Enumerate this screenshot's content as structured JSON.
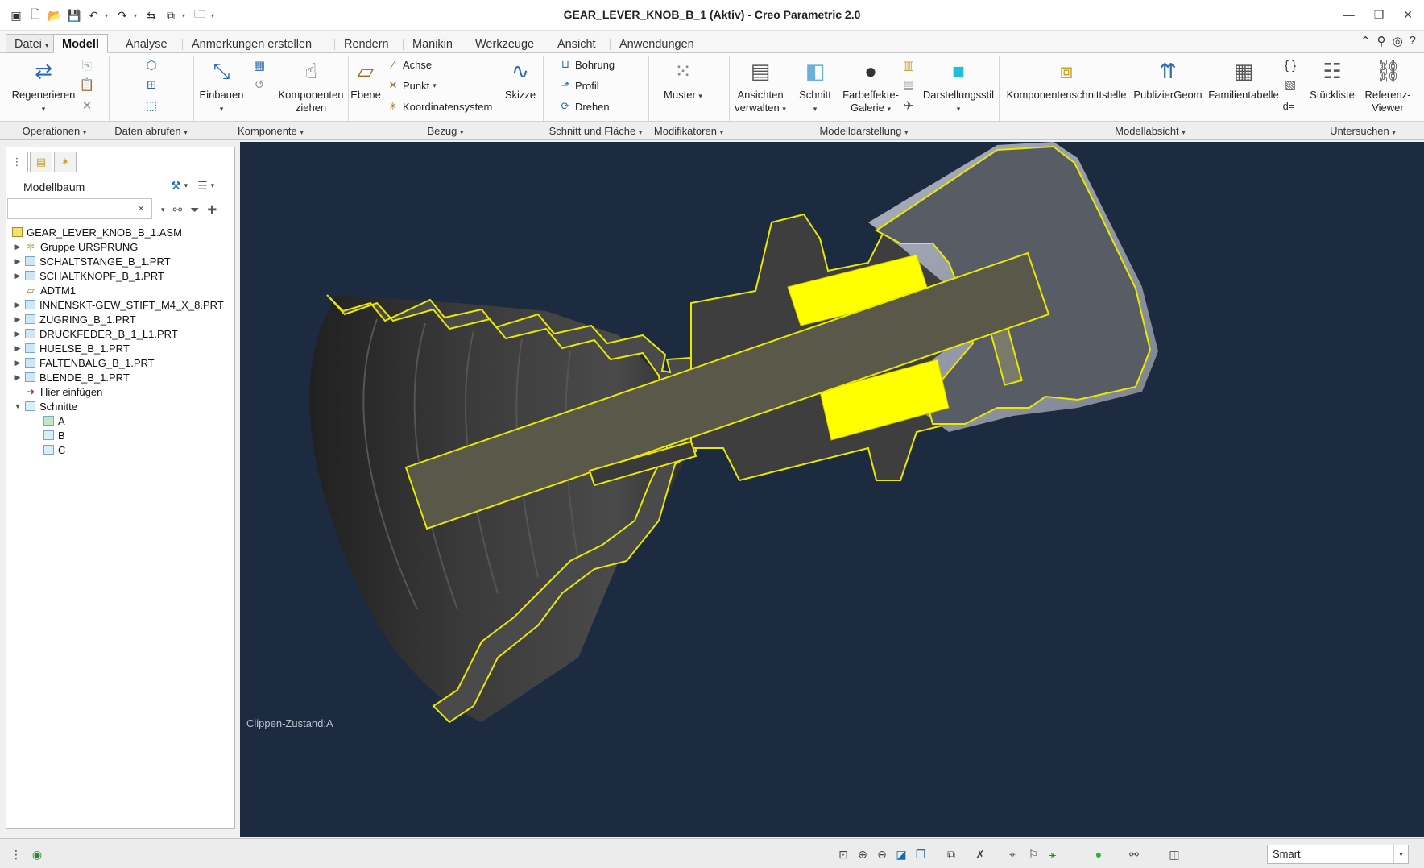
{
  "window": {
    "title": "GEAR_LEVER_KNOB_B_1 (Aktiv) - Creo Parametric 2.0"
  },
  "tabs": [
    {
      "label": "Datei"
    },
    {
      "label": "Modell"
    },
    {
      "label": "Analyse"
    },
    {
      "label": "Anmerkungen erstellen"
    },
    {
      "label": "Rendern"
    },
    {
      "label": "Manikin"
    },
    {
      "label": "Werkzeuge"
    },
    {
      "label": "Ansicht"
    },
    {
      "label": "Anwendungen"
    }
  ],
  "ribbon": {
    "regenerieren": "Regenerieren",
    "einbauen": "Einbauen",
    "komponenten_l1": "Komponenten",
    "komponenten_l2": "ziehen",
    "ebene": "Ebene",
    "achse": "Achse",
    "punkt": "Punkt",
    "koordinatensystem": "Koordinatensystem",
    "skizze": "Skizze",
    "bohrung": "Bohrung",
    "profil": "Profil",
    "drehen": "Drehen",
    "muster": "Muster",
    "ansichten_l1": "Ansichten",
    "ansichten_l2": "verwalten",
    "schnitt": "Schnitt",
    "farbeffekte_l1": "Farbeffekte-",
    "farbeffekte_l2": "Galerie",
    "darstellungsstil": "Darstellungsstil",
    "komponentenschnittstelle": "Komponentenschnittstelle",
    "publiziergeom": "PublizierGeom",
    "familientabelle": "Familientabelle",
    "stueckliste": "Stückliste",
    "referenz_l1": "Referenz-",
    "referenz_l2": "Viewer",
    "d_eq": "d="
  },
  "groups": {
    "operationen": "Operationen",
    "daten_abrufen": "Daten abrufen",
    "komponente": "Komponente",
    "bezug": "Bezug",
    "schnitt_flaeche": "Schnitt und Fläche",
    "modifikatoren": "Modifikatoren",
    "modelldarstellung": "Modelldarstellung",
    "modellabsicht": "Modellabsicht",
    "untersuchen": "Untersuchen"
  },
  "tree": {
    "header": "Modellbaum",
    "search_value": "",
    "items": [
      {
        "label": "GEAR_LEVER_KNOB_B_1.ASM"
      },
      {
        "label": "Gruppe URSPRUNG"
      },
      {
        "label": "SCHALTSTANGE_B_1.PRT"
      },
      {
        "label": "SCHALTKNOPF_B_1.PRT"
      },
      {
        "label": "ADTM1"
      },
      {
        "label": "INNENSKT-GEW_STIFT_M4_X_8.PRT"
      },
      {
        "label": "ZUGRING_B_1.PRT"
      },
      {
        "label": "DRUCKFEDER_B_1_L1.PRT"
      },
      {
        "label": "HUELSE_B_1.PRT"
      },
      {
        "label": "FALTENBALG_B_1.PRT"
      },
      {
        "label": "BLENDE_B_1.PRT"
      },
      {
        "label": "Hier einfügen"
      },
      {
        "label": "Schnitte"
      },
      {
        "label": "A"
      },
      {
        "label": "B"
      },
      {
        "label": "C"
      }
    ]
  },
  "viewport": {
    "clip_state": "Clippen-Zustand:A"
  },
  "status": {
    "selection_filter": "Smart"
  },
  "colors": {
    "viewport_bg": "#1c2b40",
    "section_highlight": "#ffff00",
    "section_edge": "#e8e800"
  }
}
